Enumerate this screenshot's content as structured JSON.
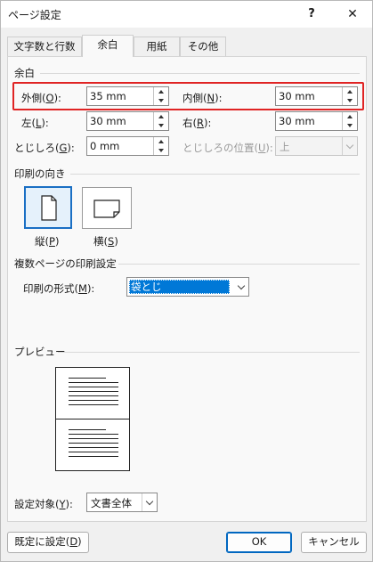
{
  "window": {
    "title": "ページ設定",
    "help_label": "?",
    "close_label": "✕"
  },
  "tabs": [
    {
      "label": "文字数と行数"
    },
    {
      "label": "余白"
    },
    {
      "label": "用紙"
    },
    {
      "label": "その他"
    }
  ],
  "margins": {
    "section_title": "余白",
    "outside": {
      "label": "外側(",
      "key": "O",
      "suffix": "):",
      "value": "35 mm"
    },
    "inside": {
      "label": "内側(",
      "key": "N",
      "suffix": "):",
      "value": "30 mm"
    },
    "left": {
      "label": "左(",
      "key": "L",
      "suffix": "):",
      "value": "30 mm"
    },
    "right": {
      "label": "右(",
      "key": "R",
      "suffix": "):",
      "value": "30 mm"
    },
    "gutter": {
      "label": "とじしろ(",
      "key": "G",
      "suffix": "):",
      "value": "0 mm"
    },
    "gutter_position": {
      "label": "とじしろの位置(",
      "key": "U",
      "suffix": "):",
      "value": "上"
    }
  },
  "orientation": {
    "section_title": "印刷の向き",
    "portrait": {
      "label": "縦(",
      "key": "P",
      "suffix": ")"
    },
    "landscape": {
      "label": "横(",
      "key": "S",
      "suffix": ")"
    }
  },
  "pages": {
    "section_title": "複数ページの印刷設定",
    "format_label": "印刷の形式(",
    "format_key": "M",
    "format_suffix": "):",
    "format_value": "袋とじ"
  },
  "preview": {
    "section_title": "プレビュー"
  },
  "apply_to": {
    "label": "設定対象(",
    "key": "Y",
    "suffix": "):",
    "value": "文書全体"
  },
  "buttons": {
    "default_label": "既定に設定(",
    "default_key": "D",
    "default_suffix": ")",
    "ok": "OK",
    "cancel": "キャンセル"
  }
}
